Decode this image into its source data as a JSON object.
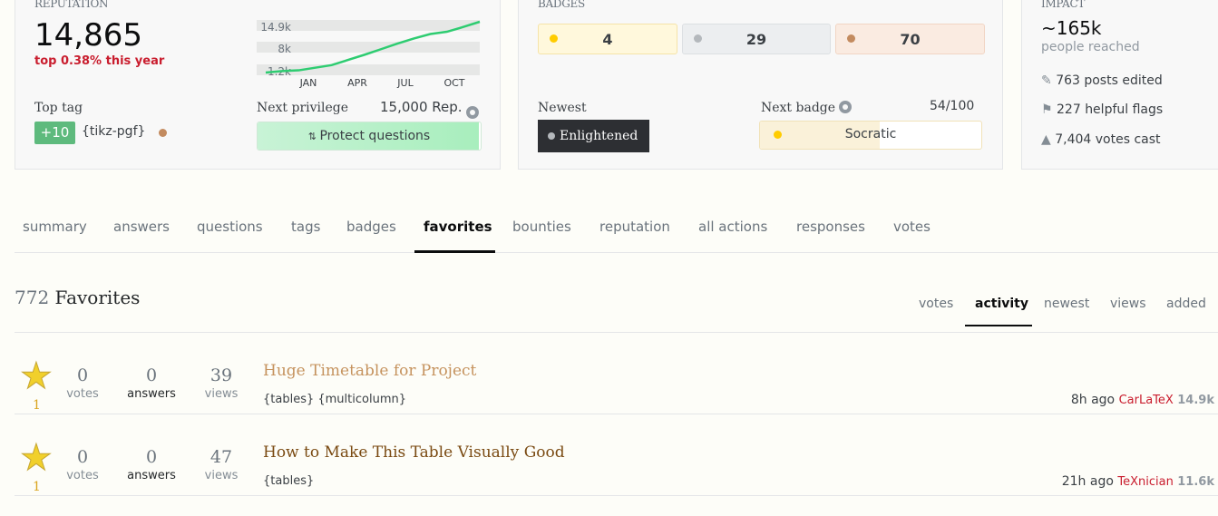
{
  "reputation": {
    "caption": "REPUTATION",
    "value": "14,865",
    "rank": "top 0.38% this year",
    "graph": {
      "y_labels": [
        "14.9k",
        "8k",
        "1.2k"
      ],
      "x_labels": [
        "JAN",
        "APR",
        "JUL",
        "OCT"
      ],
      "values": [
        1.2,
        1.6,
        1.8,
        2.5,
        3.2,
        4.6,
        6,
        7.5,
        9,
        10.4,
        11.6,
        12.2,
        13.5,
        14.9
      ],
      "line_color": "#2ecc71"
    },
    "top_tag_label": "Top tag",
    "top_tag_score": "+10",
    "top_tag": "{tikz-pgf}",
    "next_privilege_label": "Next privilege",
    "next_privilege_rep": "15,000 Rep.",
    "privilege": "Protect questions",
    "privilege_progress": 0.99
  },
  "badges": {
    "caption": "BADGES",
    "gold": "4",
    "silver": "29",
    "bronze": "70",
    "newest_label": "Newest",
    "newest": "Enlightened",
    "next_label": "Next badge",
    "next_progress_text": "54/100",
    "next": "Socratic",
    "next_progress": 0.54,
    "colors": {
      "gold": "#ffcc01",
      "silver": "#b4b8bc",
      "bronze": "#d1a684"
    }
  },
  "impact": {
    "caption": "IMPACT",
    "reached": "~165k",
    "reached_label": "people reached",
    "edited": "763 posts edited",
    "flags": "227 helpful flags",
    "votes": "7,404 votes cast"
  },
  "tabs": [
    "summary",
    "answers",
    "questions",
    "tags",
    "badges",
    "favorites",
    "bounties",
    "reputation",
    "all actions",
    "responses",
    "votes"
  ],
  "favorites": {
    "count": "772",
    "label": "Favorites",
    "sort": [
      "votes",
      "activity",
      "newest",
      "views",
      "added"
    ],
    "items": [
      {
        "fav": "1",
        "votes": "0",
        "votes_label": "votes",
        "answers": "0",
        "answers_label": "answers",
        "views": "39",
        "views_label": "views",
        "title": "Huge Timetable for Project",
        "title_color": "#c5925d",
        "tags": [
          "{tables}",
          "{multicolumn}"
        ],
        "time": "8h ago",
        "user": "CarLaTeX",
        "rep": "14.9k"
      },
      {
        "fav": "1",
        "votes": "0",
        "votes_label": "votes",
        "answers": "0",
        "answers_label": "answers",
        "views": "47",
        "views_label": "views",
        "title": "How to Make This Table Visually Good",
        "title_color": "#7a4a12",
        "tags": [
          "{tables}"
        ],
        "time": "21h ago",
        "user": "TeXnician",
        "rep": "11.6k"
      }
    ]
  }
}
